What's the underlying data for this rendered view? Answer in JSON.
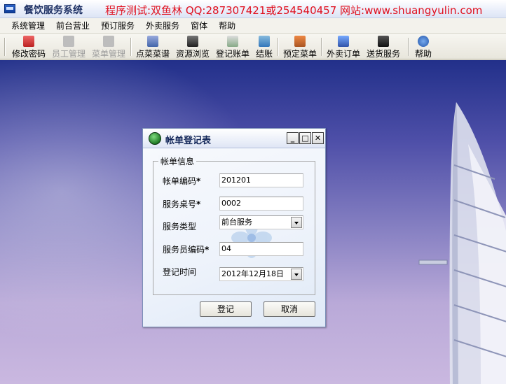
{
  "app": {
    "title": "餐饮服务系统",
    "banner": "程序测试:双鱼林 QQ:287307421或254540457 网站:www.shuangyulin.com"
  },
  "menu": [
    "系统管理",
    "前台营业",
    "预订服务",
    "外卖服务",
    "窗体",
    "帮助"
  ],
  "toolbar": {
    "change_password": "修改密码",
    "staff_manage": "员工管理",
    "dish_manage": "菜单管理",
    "order_dishes": "点菜菜谱",
    "resource_browse": "资源浏览",
    "register_bill": "登记账单",
    "checkout": "结账",
    "reserve_menu": "预定菜单",
    "takeout_order": "外卖订单",
    "delivery_service": "送货服务",
    "help": "帮助"
  },
  "dialog": {
    "title": "帐单登记表",
    "group_title": "帐单信息",
    "bill_code_label": "帐单编码",
    "bill_code_value": "201201",
    "table_no_label": "服务桌号",
    "table_no_value": "0002",
    "service_type_label": "服务类型",
    "service_type_value": "前台服务",
    "waiter_code_label": "服务员编码",
    "waiter_code_value": "04",
    "register_time_label": "登记时间",
    "register_time_value": "2012年12月18日",
    "required_mark": "*",
    "submit_label": "登记",
    "cancel_label": "取消",
    "minimize_glyph": "_",
    "maximize_glyph": "□",
    "close_glyph": "✕"
  },
  "colors": {
    "banner": "#e0101e",
    "desktop_top": "#22308a",
    "desktop_bottom": "#cab8e0"
  }
}
